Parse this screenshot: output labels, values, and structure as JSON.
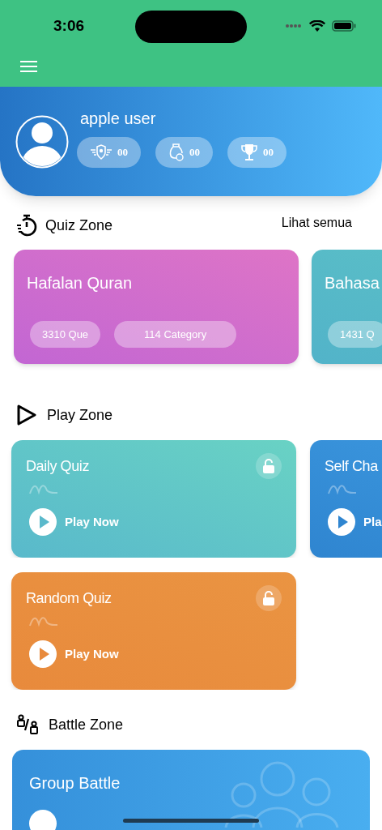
{
  "status_bar": {
    "time": "3:06"
  },
  "profile": {
    "name": "apple user",
    "stats": [
      {
        "value": "00"
      },
      {
        "value": "00"
      },
      {
        "value": "00"
      }
    ]
  },
  "quiz_zone": {
    "title": "Quiz Zone",
    "see_all": "Lihat semua",
    "categories": [
      {
        "title": "Hafalan Quran",
        "chips": [
          "3310 Que",
          "114 Category"
        ]
      },
      {
        "title": "Bahasa",
        "chips": [
          "1431 Q"
        ]
      }
    ]
  },
  "play_zone": {
    "title": "Play Zone",
    "rows": [
      [
        {
          "title": "Daily Quiz",
          "action": "Play Now"
        },
        {
          "title": "Self Cha",
          "action": "Pla"
        }
      ],
      [
        {
          "title": "Random Quiz",
          "action": "Play Now"
        }
      ]
    ]
  },
  "battle_zone": {
    "title": "Battle Zone",
    "cards": [
      {
        "title": "Group Battle"
      }
    ]
  }
}
